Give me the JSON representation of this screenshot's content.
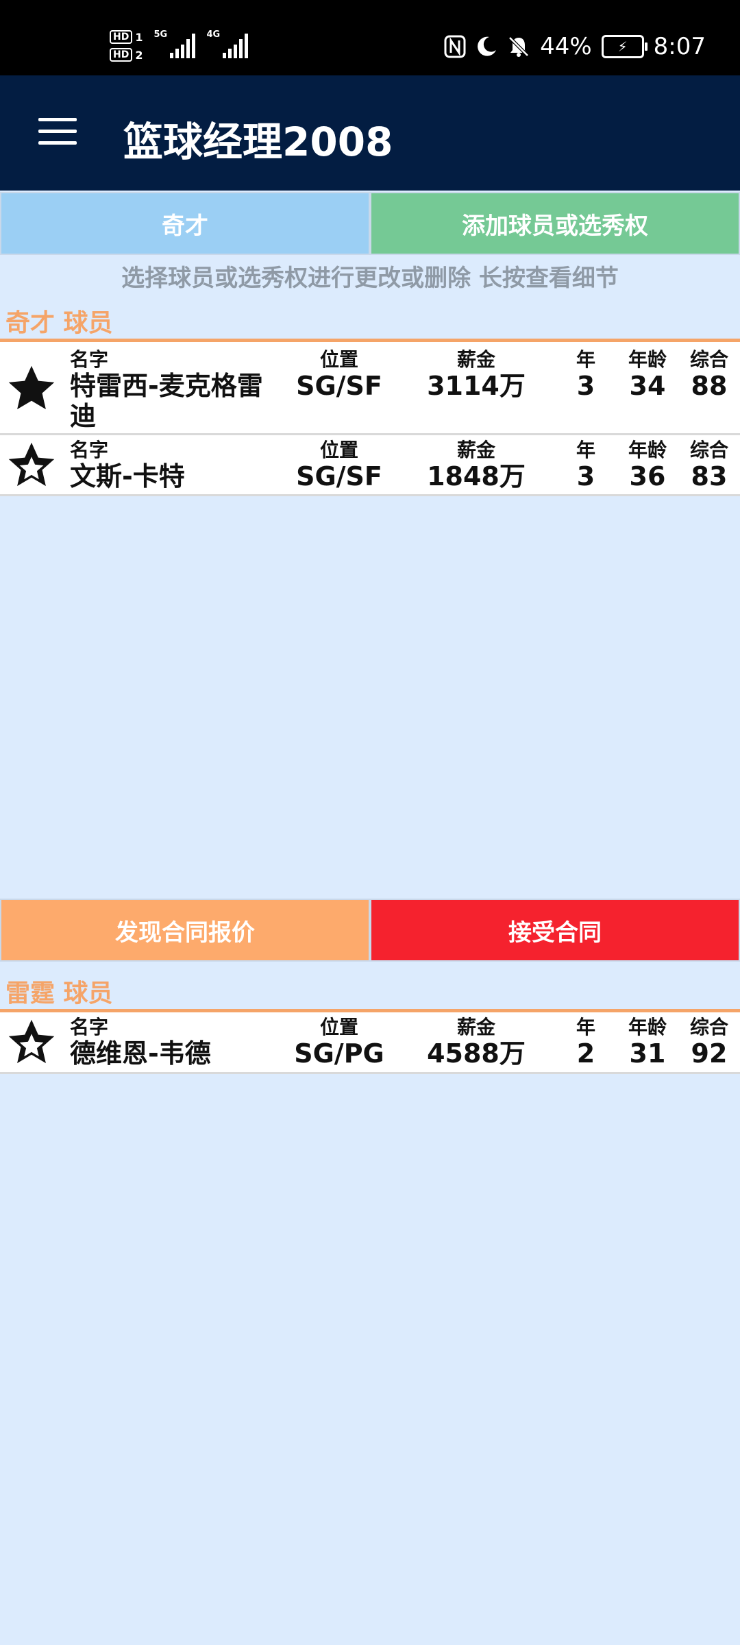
{
  "status_bar": {
    "hd1": "HD",
    "sim1": "1",
    "hd2": "HD",
    "sim2": "2",
    "net1": "5G",
    "net2": "4G",
    "battery": "44%",
    "time": "8:07",
    "icons": [
      "nfc-icon",
      "moon-icon",
      "bell-off-icon",
      "battery-charging-icon"
    ]
  },
  "app_bar": {
    "title": "篮球经理2008",
    "menu_icon": "hamburger-menu-icon"
  },
  "top_buttons": {
    "team": "奇才",
    "add": "添加球员或选秀权",
    "team_color": "#9bcff4",
    "add_color": "#75c995"
  },
  "hint": "选择球员或选秀权进行更改或删除 长按查看细节",
  "section1": {
    "label": "奇才 球员",
    "players": [
      {
        "name": "特雷西-麦克格雷迪",
        "pos": "SG/SF",
        "salary": "3114万",
        "years": "3",
        "age": "34",
        "overall": "88"
      },
      {
        "name": "文斯-卡特",
        "pos": "SG/SF",
        "salary": "1848万",
        "years": "3",
        "age": "36",
        "overall": "83"
      }
    ]
  },
  "headers": {
    "name": "名字",
    "pos": "位置",
    "salary": "薪金",
    "years": "年",
    "age": "年龄",
    "overall": "综合"
  },
  "mid_buttons": {
    "find": "发现合同报价",
    "accept": "接受合同",
    "find_color": "#fdaa6c",
    "accept_color": "#f5222e"
  },
  "section2": {
    "label": "雷霆 球员",
    "players": [
      {
        "name": "德维恩-韦德",
        "pos": "SG/PG",
        "salary": "4588万",
        "years": "2",
        "age": "31",
        "overall": "92"
      }
    ]
  }
}
